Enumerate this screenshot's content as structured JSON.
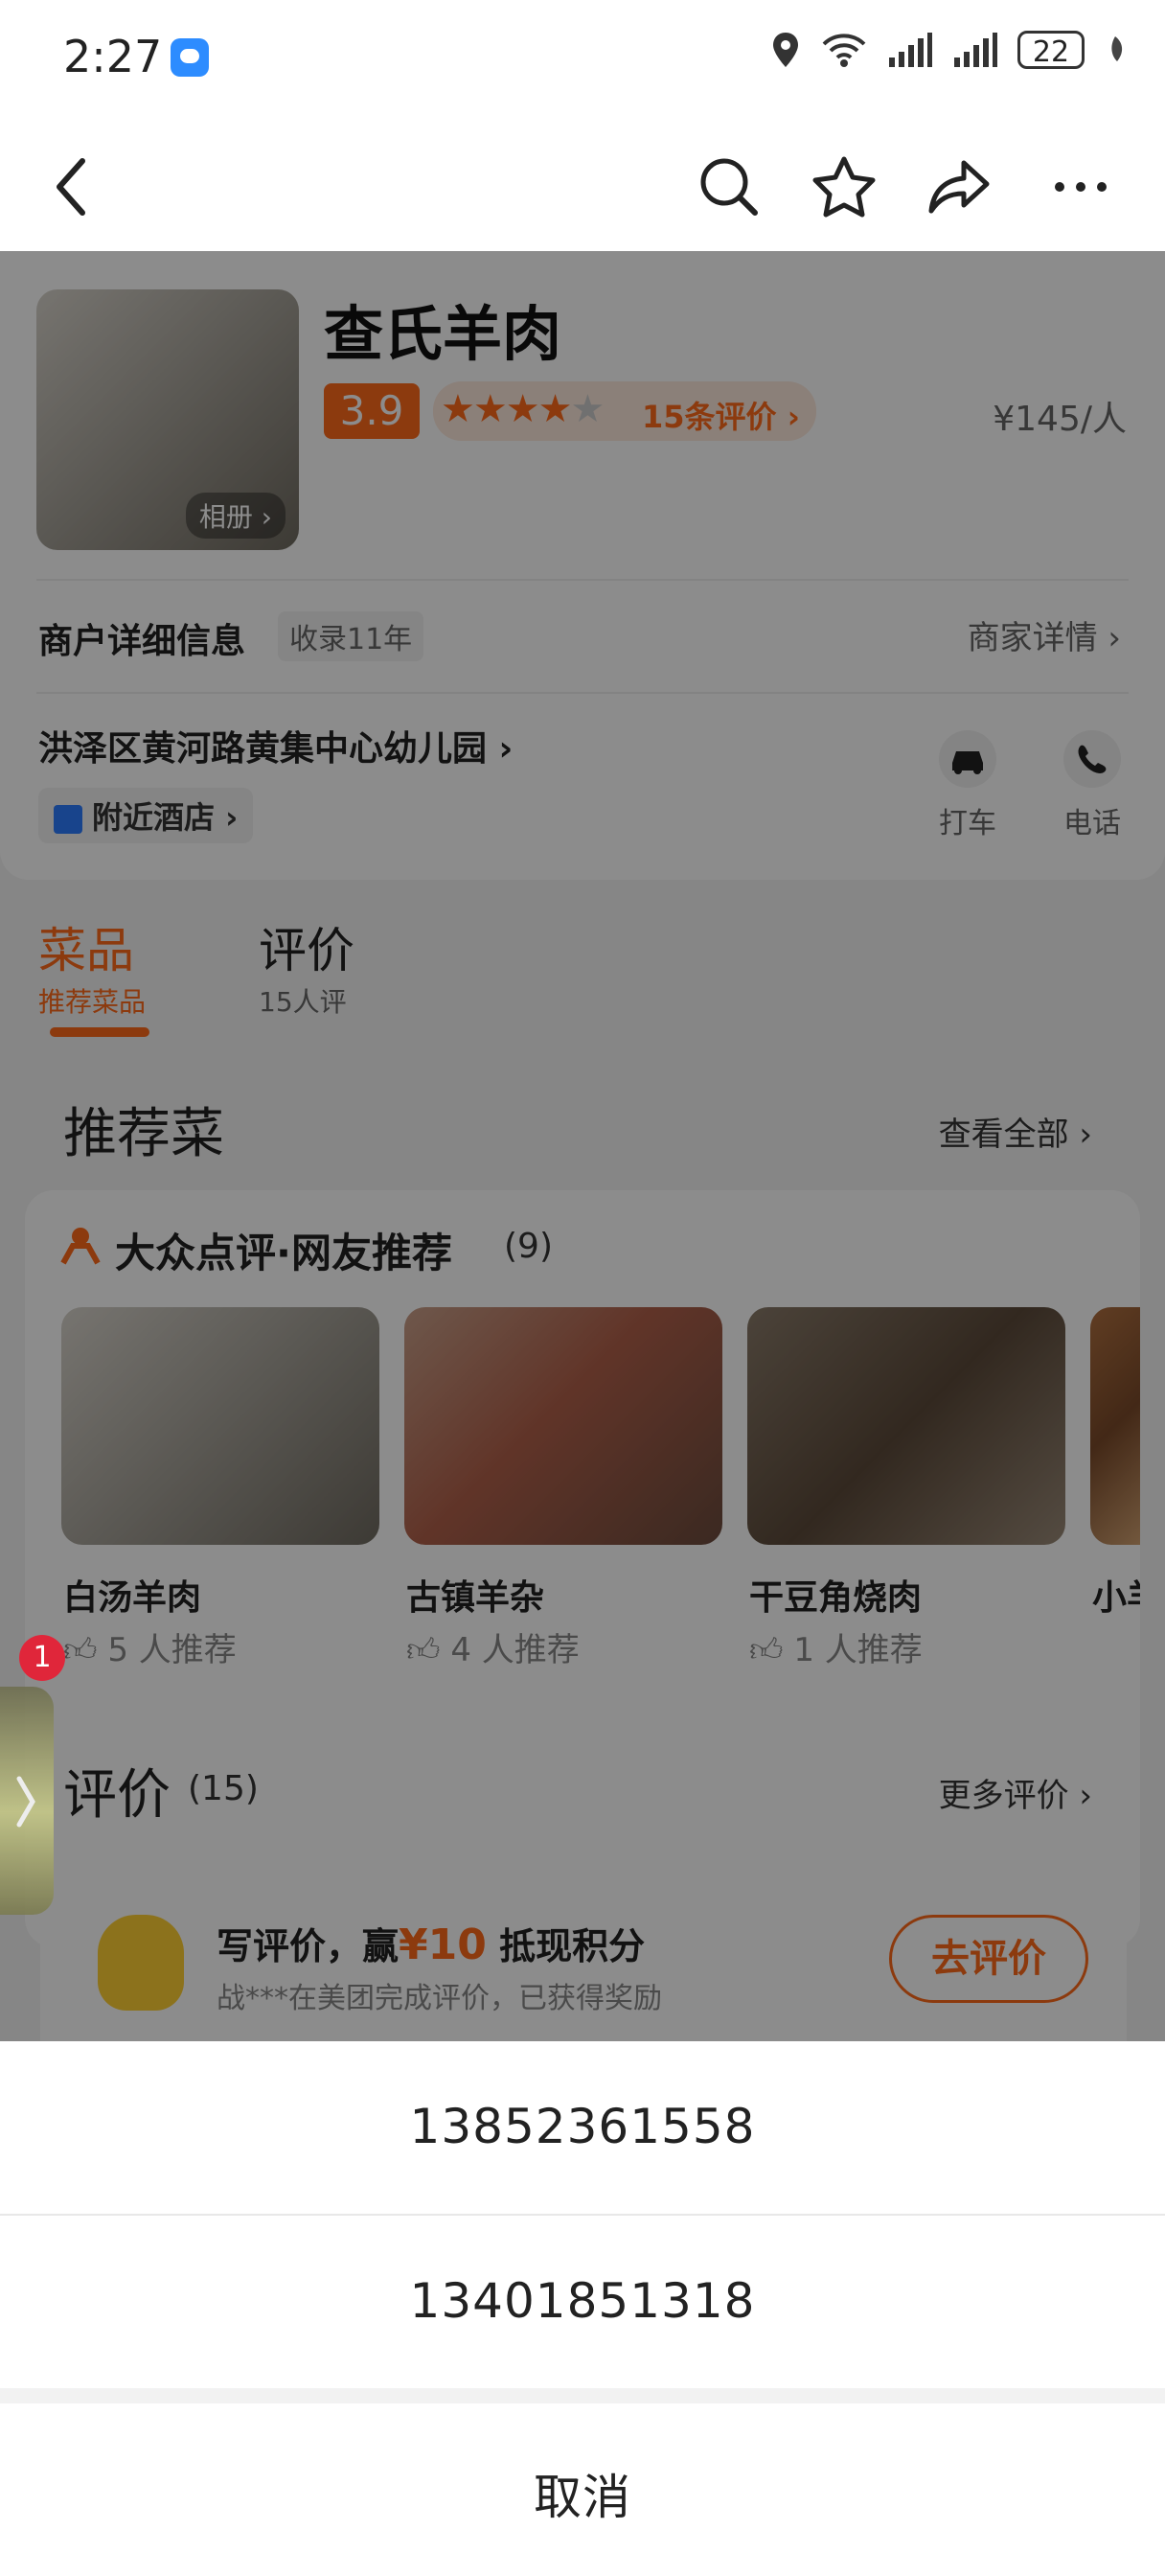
{
  "status_bar": {
    "time": "2:27",
    "battery": "22"
  },
  "nav": {
    "icons": [
      "back-icon",
      "search-icon",
      "star-icon",
      "share-icon",
      "more-icon"
    ]
  },
  "shop": {
    "name": "查氏羊肉",
    "rating": "3.9",
    "reviews_link": "15条评价",
    "price": "¥145/人",
    "album_label": "相册",
    "info_label": "商户详细信息",
    "info_badge": "收录11年",
    "details_link": "商家详情",
    "address": "洪泽区黄河路黄集中心幼儿园",
    "nearby_hotel": "附近酒店",
    "taxi_label": "打车",
    "phone_label": "电话"
  },
  "tabs": [
    {
      "title": "菜品",
      "sub": "推荐菜品"
    },
    {
      "title": "评价",
      "sub": "15人评"
    }
  ],
  "recommend": {
    "title": "推荐菜",
    "view_all": "查看全部",
    "community_title": "大众点评·网友推荐",
    "community_count": "(9)",
    "dishes": [
      {
        "name": "白汤羊肉",
        "likes": "5 人推荐"
      },
      {
        "name": "古镇羊杂",
        "likes": "4 人推荐"
      },
      {
        "name": "干豆角烧肉",
        "likes": "1 人推荐"
      },
      {
        "name": "小羊",
        "likes": ""
      }
    ]
  },
  "reviews": {
    "title": "评价",
    "count": "(15)",
    "more": "更多评价",
    "promo_prefix": "写评价，赢",
    "promo_amount": "¥10",
    "promo_suffix": "抵现积分",
    "promo_sub": "战***在美团完成评价，已获得奖励",
    "promo_button": "去评价"
  },
  "floating_badge": "1",
  "sheet": {
    "phones": [
      "13852361558",
      "13401851318"
    ],
    "cancel": "取消"
  },
  "colors": {
    "accent": "#ff6a1a",
    "dim": "rgba(0,0,0,0.45)"
  }
}
